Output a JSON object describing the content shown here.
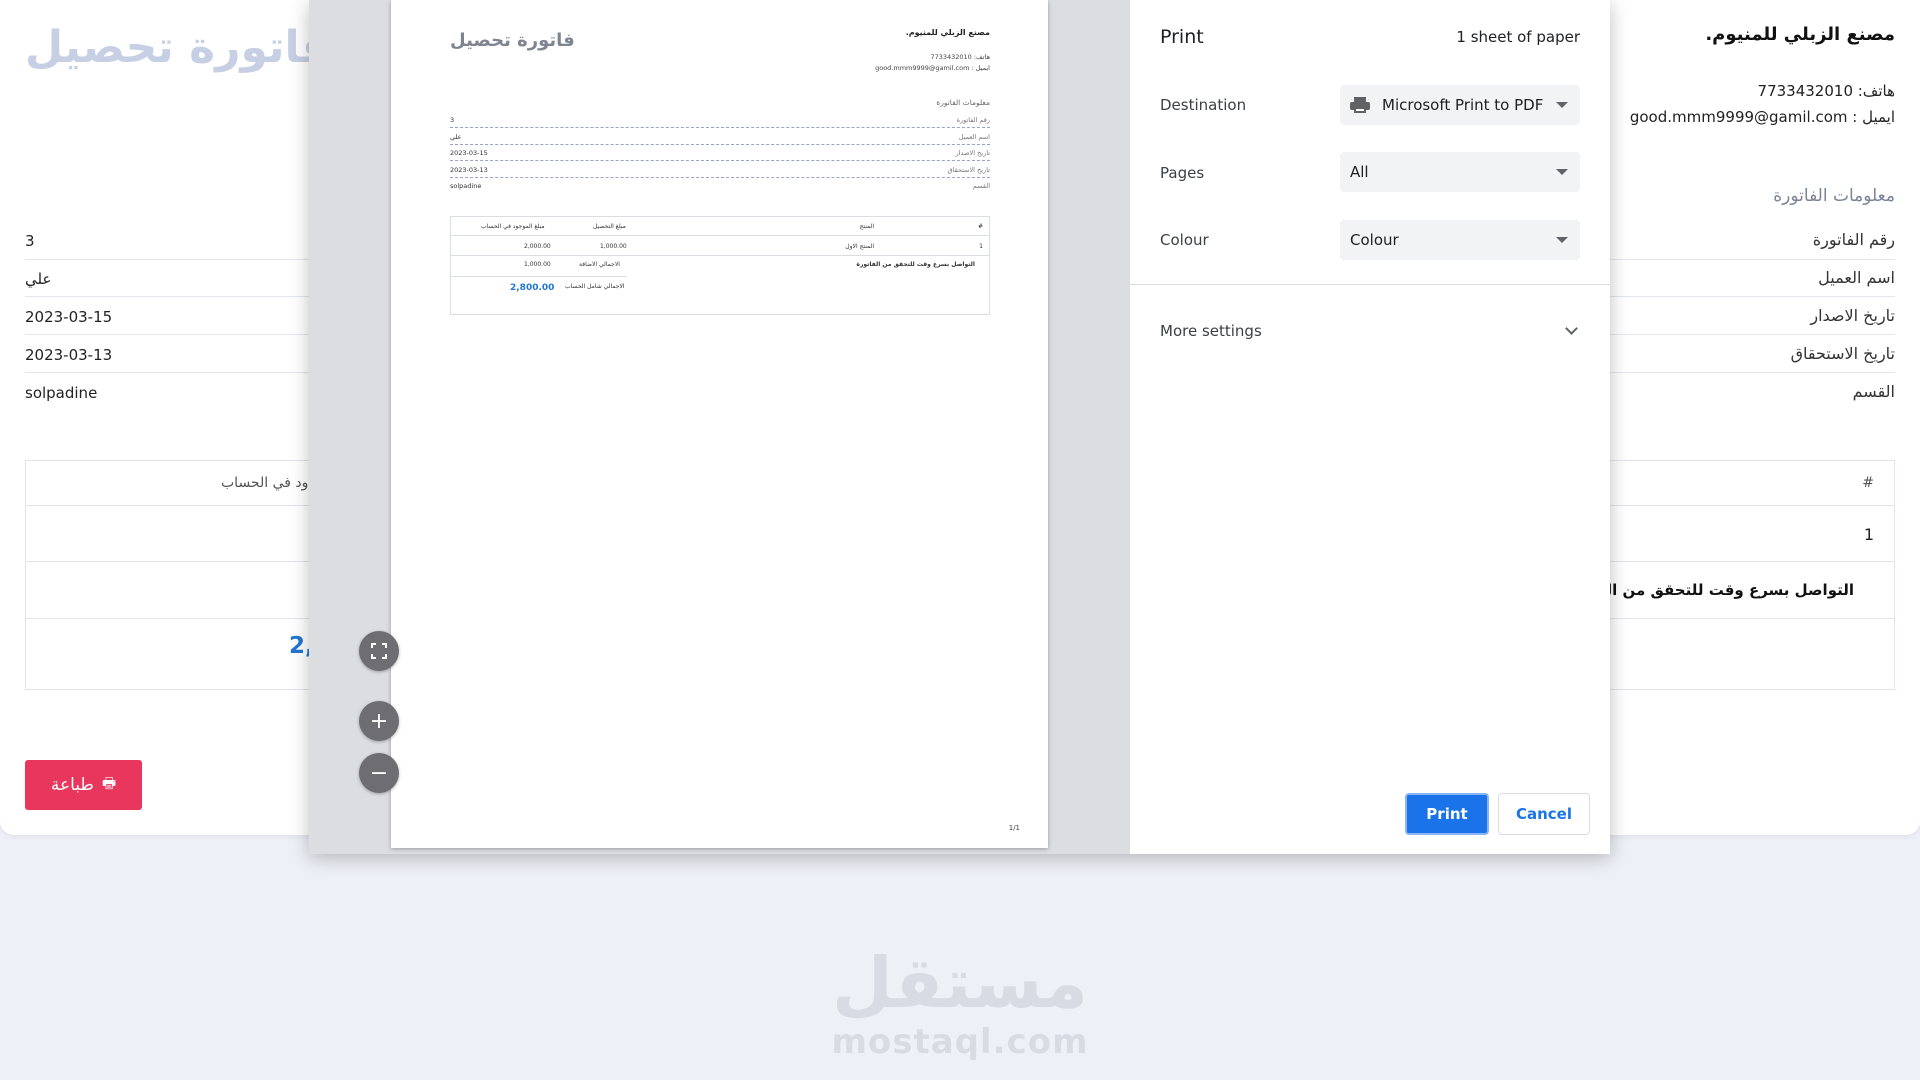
{
  "invoice": {
    "title": "فاتورة تحصيل",
    "company_name": "مصنع الزبلي للمنيوم.",
    "phone": "هاتف: 7733432010",
    "email": "ايميل : good.mmm9999@gamil.com",
    "info_heading": "معلومات الفاتورة",
    "fields": [
      {
        "label": "رقم الفاتورة",
        "value": "3"
      },
      {
        "label": "اسم العميل",
        "value": "علي"
      },
      {
        "label": "تاريخ الاصدار",
        "value": "2023-03-15"
      },
      {
        "label": "تاريخ الاستحقاق",
        "value": "2023-03-13"
      },
      {
        "label": "القسم",
        "value": "solpadine"
      }
    ],
    "table": {
      "header_hash": "#",
      "header_amount_visible": "ود في الحساب",
      "row_number": "1",
      "note_visible": "التواصل بسرع وقت للتحقق من الف",
      "total_visible": "2,"
    },
    "print_button": "طباعة",
    "print_icon": "printer-icon"
  },
  "watermark": {
    "logo": "مستقل",
    "url": "mostaql.com"
  },
  "preview": {
    "company_name": "مصنع الزبلي للمنيوم.",
    "phone": "هاتف: 7733432010",
    "email": "ايميل : good.mmm9999@gamil.com",
    "title": "فاتورة تحصيل",
    "info_heading": "معلومات الفاتورة",
    "fields": [
      {
        "label": "رقم الفاتورة",
        "value": "3"
      },
      {
        "label": "اسم العميل",
        "value": "علي"
      },
      {
        "label": "تاريخ الاصدار",
        "value": "2023-03-15"
      },
      {
        "label": "تاريخ الاستحقاق",
        "value": "2023-03-13"
      },
      {
        "label": "القسم",
        "value": "solpadine"
      }
    ],
    "table": {
      "col_hash": "#",
      "col_product": "المنتج",
      "col_collected": "مبلغ التحصيل",
      "col_balance": "مبلغ الموجود في الحساب",
      "row_num": "1",
      "row_product": "المنتج الاول",
      "row_collected": "1,000.00",
      "row_balance": "2,000.00",
      "note": "التواصل بسرع وقت للتحقق من الفاتورة",
      "added_total_label": "الاجمالي الاضافة",
      "added_total_value": "1,000.00",
      "grand_total_label": "الاجمالي شامل الحساب",
      "grand_total_value": "2,800.00"
    },
    "page_number": "1/1"
  },
  "print_settings": {
    "title": "Print",
    "sheets": "1 sheet of paper",
    "destination_label": "Destination",
    "destination_value": "Microsoft Print to PDF",
    "pages_label": "Pages",
    "pages_value": "All",
    "colour_label": "Colour",
    "colour_value": "Colour",
    "more_settings": "More settings",
    "print_button": "Print",
    "cancel_button": "Cancel"
  },
  "zoom_controls": {
    "fit_icon": "fit-to-page-icon",
    "zoom_in_icon": "plus-icon",
    "zoom_out_icon": "minus-icon",
    "plus_glyph": "+",
    "minus_glyph": "−"
  }
}
